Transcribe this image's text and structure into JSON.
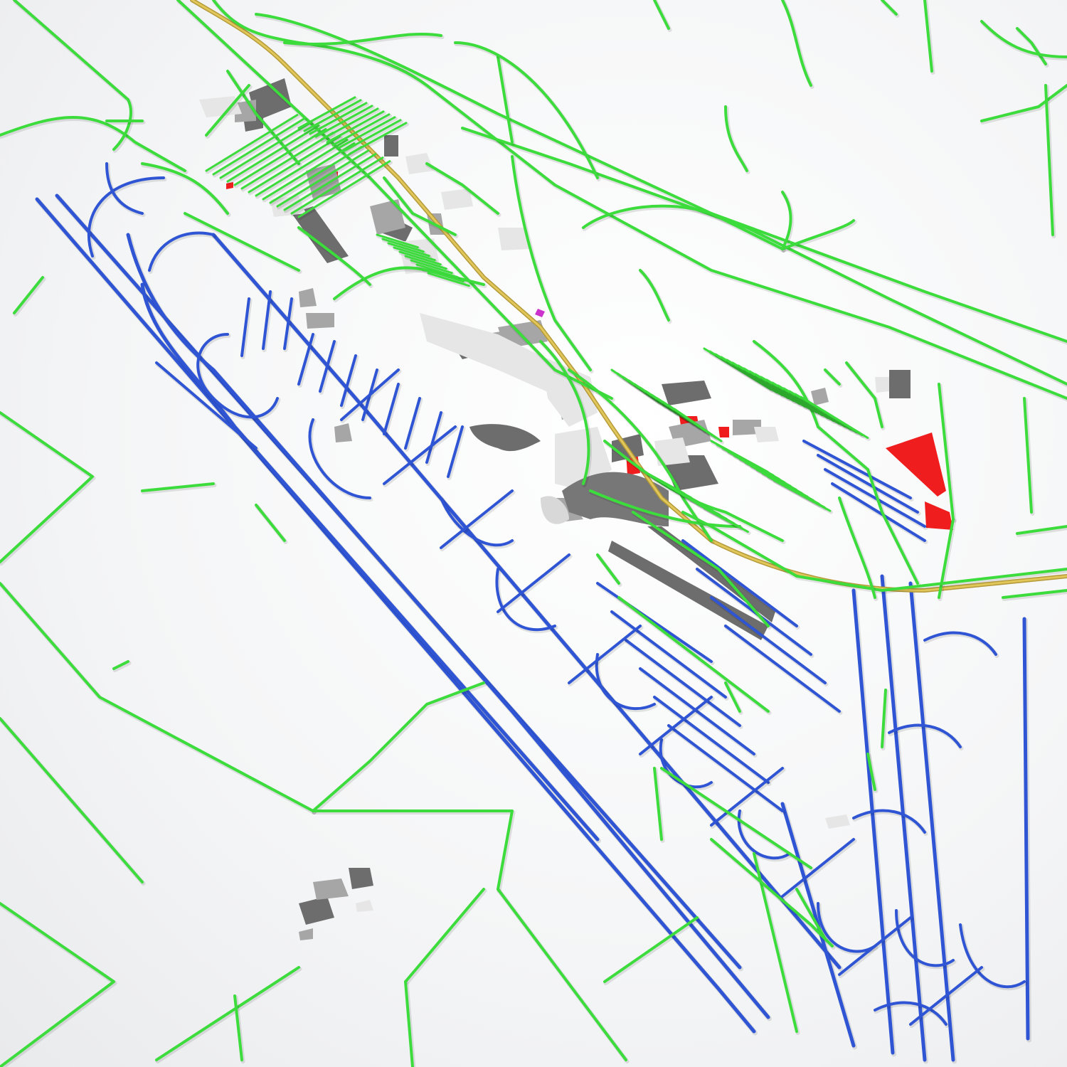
{
  "map": {
    "colors": {
      "background": "#f2f3f4",
      "road": "#3ddc3d",
      "road_dark": "#2db52d",
      "taxiway": "#2f55d4",
      "railway": "#e1c75a",
      "building_dark": "#6d6d6d",
      "building_mid": "#a6a6a6",
      "building_light": "#e6e6e6",
      "landuse_highlight": "#ef1d1d",
      "marker": "#cc33cc"
    },
    "layers": [
      {
        "name": "roads",
        "icon": "road-network-icon"
      },
      {
        "name": "taxiways-runways",
        "icon": "taxiway-network-icon"
      },
      {
        "name": "railway",
        "icon": "railway-icon"
      },
      {
        "name": "buildings",
        "icon": "building-icon"
      },
      {
        "name": "highlighted-areas",
        "icon": "area-highlight-icon"
      }
    ]
  }
}
